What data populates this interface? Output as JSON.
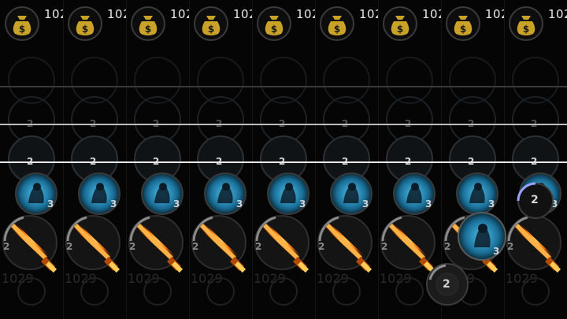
{
  "hud": {
    "money_count": "1029",
    "money_icon": "money-bag-icon",
    "accent_gold": "#c9a227",
    "accent_cyan": "#2aa6d8",
    "accent_fire": "#ff6a00"
  },
  "inventory": {
    "stack_label": "2",
    "spirit_stack": "3",
    "sword_stack": "2"
  },
  "columns": [
    {
      "id": "frame-1"
    },
    {
      "id": "frame-2"
    },
    {
      "id": "frame-3"
    },
    {
      "id": "frame-4"
    },
    {
      "id": "frame-5"
    },
    {
      "id": "frame-6"
    },
    {
      "id": "frame-7"
    },
    {
      "id": "frame-8"
    },
    {
      "id": "frame-9"
    }
  ],
  "floating": {
    "spirit_stack": "3",
    "shield_stack": "2",
    "badge_stack": "2"
  }
}
